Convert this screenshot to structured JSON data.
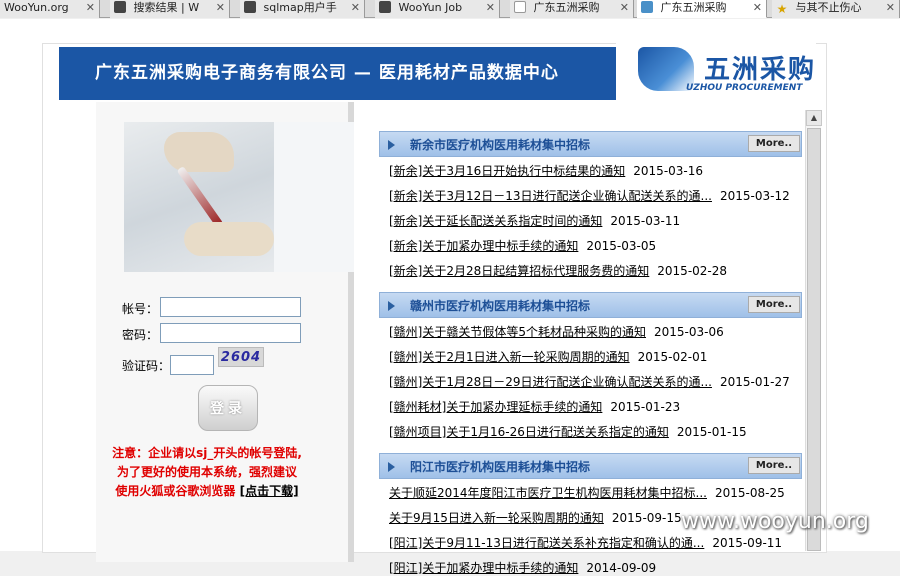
{
  "tabs": [
    {
      "label": "WooYun.org",
      "icon": "none"
    },
    {
      "label": "搜索结果 | W",
      "icon": "app"
    },
    {
      "label": "sqlmap用户手",
      "icon": "app"
    },
    {
      "label": "WooYun Job",
      "icon": "app"
    },
    {
      "label": "广东五洲采购",
      "icon": "blank"
    },
    {
      "label": "广东五洲采购",
      "icon": "blue"
    },
    {
      "label": "与其不止伤心",
      "icon": "star"
    }
  ],
  "banner": {
    "title": "广东五洲采购电子商务有限公司 — 医用耗材产品数据中心"
  },
  "logo": {
    "cn": "五洲采购",
    "en": "UZHOU PROCUREMENT"
  },
  "login": {
    "account_label": "帐号：",
    "password_label": "密码：",
    "captcha_label": "验证码：",
    "captcha_text": "2604",
    "login_button": "登录"
  },
  "notice": {
    "line1": "注意：企业请以sj_开头的帐号登陆,",
    "line2": "为了更好的使用本系统，强烈建议",
    "line3": "使用火狐或谷歌浏览器",
    "download": "[点击下载]"
  },
  "sections": [
    {
      "title": "新余市医疗机构医用耗材集中招标",
      "more": "More..",
      "items": [
        {
          "text": "[新余]关于3月16日开始执行中标结果的通知",
          "date": "2015-03-16"
        },
        {
          "text": "[新余]关于3月12日－13日进行配送企业确认配送关系的通...",
          "date": "2015-03-12"
        },
        {
          "text": "[新余]关于延长配送关系指定时间的通知",
          "date": "2015-03-11"
        },
        {
          "text": "[新余]关于加紧办理中标手续的通知",
          "date": "2015-03-05"
        },
        {
          "text": "[新余]关于2月28日起结算招标代理服务费的通知",
          "date": "2015-02-28"
        }
      ]
    },
    {
      "title": "赣州市医疗机构医用耗材集中招标",
      "more": "More..",
      "items": [
        {
          "text": "[赣州]关于赣关节假体等5个耗材品种采购的通知",
          "date": "2015-03-06"
        },
        {
          "text": "[赣州]关于2月1日进入新一轮采购周期的通知",
          "date": "2015-02-01"
        },
        {
          "text": "[赣州]关于1月28日－29日进行配送企业确认配送关系的通...",
          "date": "2015-01-27"
        },
        {
          "text": "[赣州耗材]关于加紧办理延标手续的通知",
          "date": "2015-01-23"
        },
        {
          "text": "[赣州项目]关于1月16-26日进行配送关系指定的通知",
          "date": "2015-01-15"
        }
      ]
    },
    {
      "title": "阳江市医疗机构医用耗材集中招标",
      "more": "More..",
      "items": [
        {
          "text": "关于顺延2014年度阳江市医疗卫生机构医用耗材集中招标...",
          "date": "2015-08-25"
        },
        {
          "text": "关于9月15日进入新一轮采购周期的通知",
          "date": "2015-09-15"
        },
        {
          "text": "[阳江]关于9月11-13日进行配送关系补充指定和确认的通...",
          "date": "2015-09-11"
        },
        {
          "text": "[阳江]关于加紧办理中标手续的通知",
          "date": "2014-09-09"
        }
      ]
    }
  ],
  "watermark": "www.wooyun.org"
}
